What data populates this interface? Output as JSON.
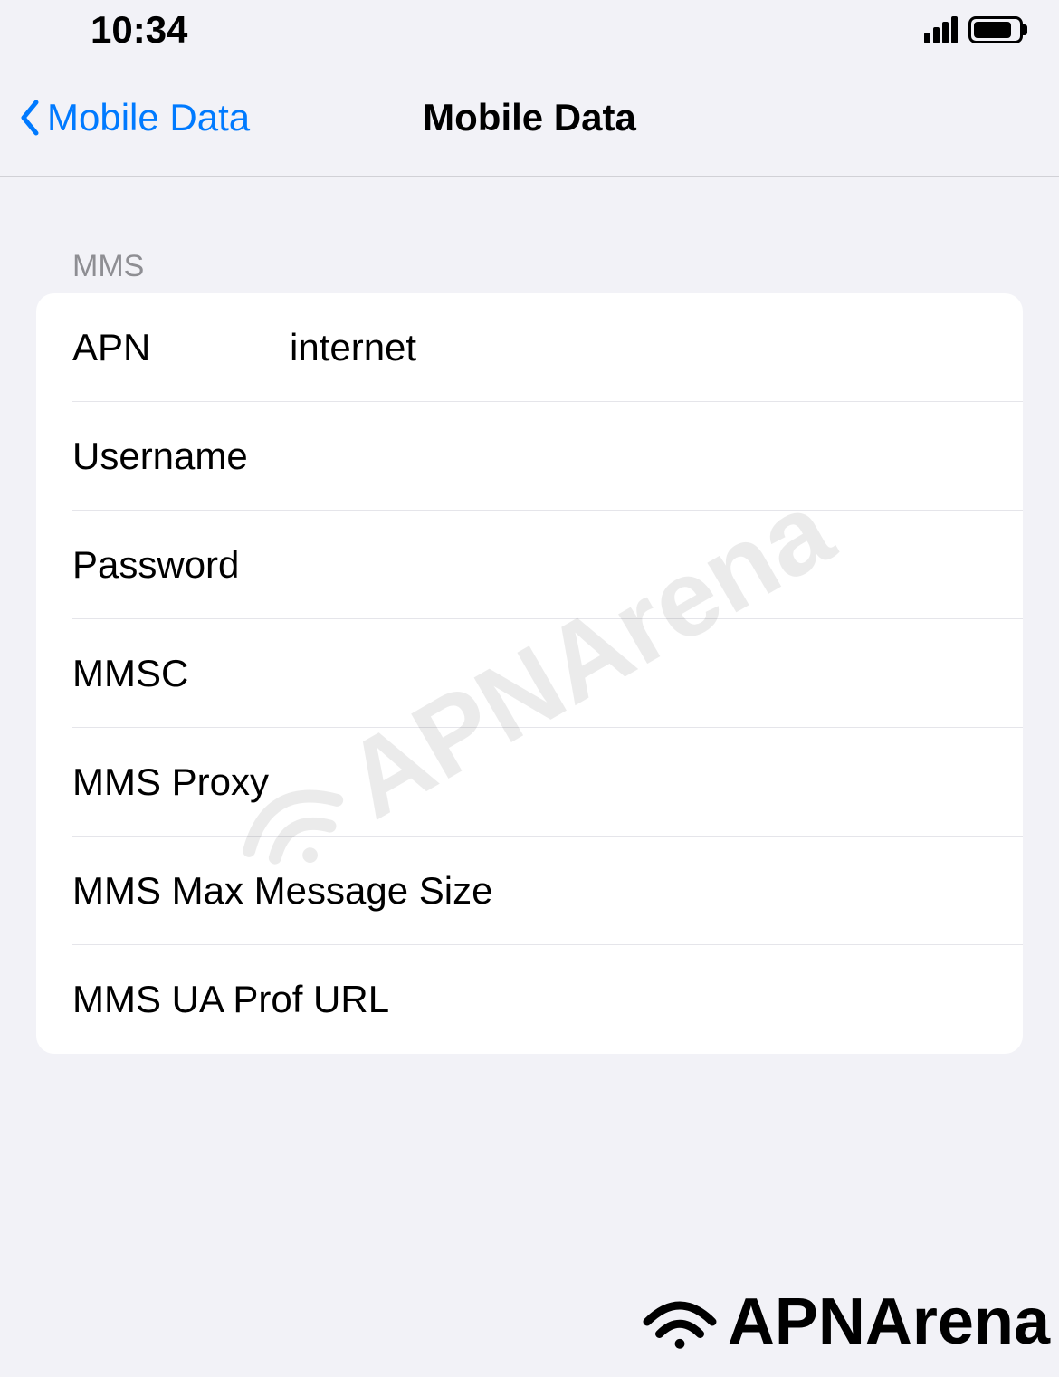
{
  "statusBar": {
    "time": "10:34"
  },
  "navBar": {
    "backLabel": "Mobile Data",
    "title": "Mobile Data"
  },
  "section": {
    "header": "MMS",
    "rows": [
      {
        "label": "APN",
        "value": "internet"
      },
      {
        "label": "Username",
        "value": ""
      },
      {
        "label": "Password",
        "value": ""
      },
      {
        "label": "MMSC",
        "value": ""
      },
      {
        "label": "MMS Proxy",
        "value": ""
      },
      {
        "label": "MMS Max Message Size",
        "value": ""
      },
      {
        "label": "MMS UA Prof URL",
        "value": ""
      }
    ]
  },
  "watermark": {
    "text": "APNArena"
  },
  "logo": {
    "text": "APNArena"
  }
}
